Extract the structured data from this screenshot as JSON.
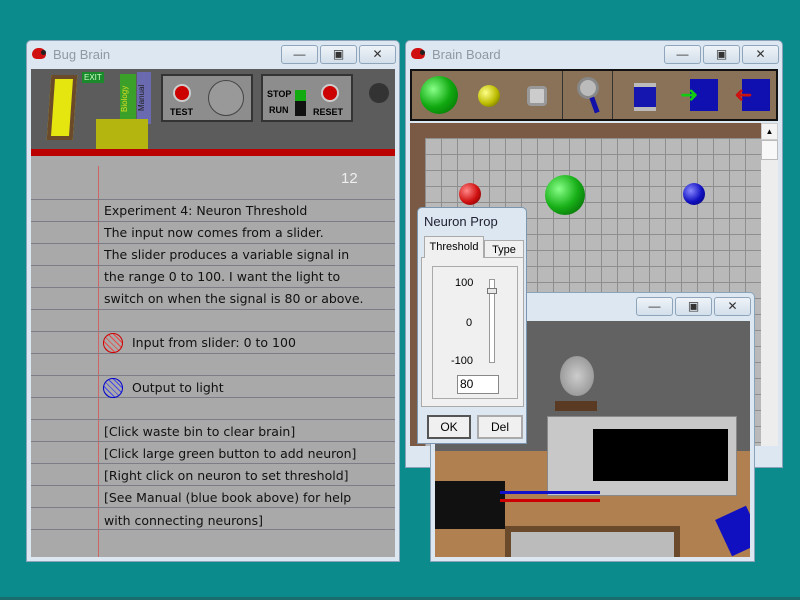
{
  "bug_brain": {
    "title": "Bug Brain",
    "exit_sign": "EXIT",
    "books": [
      "Biology",
      "Manual"
    ],
    "test_label": "TEST",
    "stop_label": "STOP",
    "run_label": "RUN",
    "reset_label": "RESET",
    "notebook": {
      "page_number": "12",
      "lines": [
        "Experiment 4: Neuron Threshold",
        "The input now comes from a slider.",
        "The slider produces a variable signal in",
        "the range 0 to 100. I want the light to",
        "switch on when the signal is 80 or above."
      ],
      "input_legend": "Input from slider: 0 to 100",
      "output_legend": "Output to light",
      "instructions": [
        "[Click waste bin to clear brain]",
        "[Click large green button to add neuron]",
        "[Right click on neuron to set threshold]",
        "[See Manual (blue book above) for help",
        "with connecting neurons]"
      ]
    }
  },
  "brain_board": {
    "title": "Brain Board"
  },
  "neuron_prop": {
    "title": "Neuron Prop",
    "tabs": [
      "Threshold",
      "Type"
    ],
    "scale": {
      "max": "100",
      "mid": "0",
      "min": "-100"
    },
    "threshold_value": "80",
    "slider_fraction": 0.9,
    "ok_label": "OK",
    "del_label": "Del"
  },
  "colors": {
    "desktop": "#0b8b8b",
    "input_neuron": "#d01010",
    "neuron": "#18b018",
    "output_neuron": "#1010c0"
  }
}
